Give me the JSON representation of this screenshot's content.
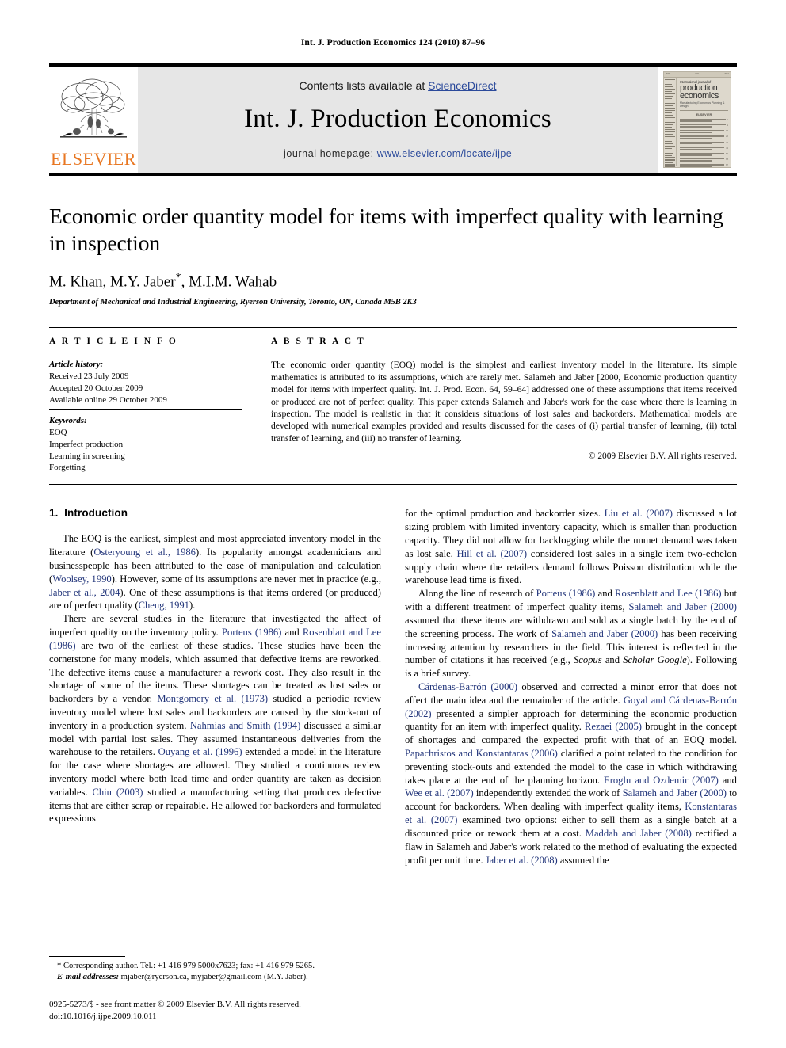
{
  "running_head": "Int. J. Production Economics 124 (2010) 87–96",
  "masthead": {
    "contents_prefix": "Contents lists available at ",
    "sciencedirect": "ScienceDirect",
    "journal_title": "Int. J. Production Economics",
    "homepage_prefix": "journal homepage: ",
    "homepage_url": "www.elsevier.com/locate/ijpe",
    "publisher": "ELSEVIER",
    "cover": {
      "line1": "International journal of",
      "line2a": "production",
      "line2b": "economics",
      "line3": "Manufacturing Economics Planning & Design"
    },
    "link_color": "#2b4a9b",
    "elsevier_orange": "#E87722"
  },
  "title": "Economic order quantity model for items with imperfect quality with learning in inspection",
  "authors": "M. Khan, M.Y. Jaber",
  "authors_tail": ", M.I.M. Wahab",
  "affiliation": "Department of Mechanical and Industrial Engineering, Ryerson University, Toronto, ON, Canada M5B 2K3",
  "article_info": {
    "label": "A R T I C L E   I N F O",
    "history_label": "Article history:",
    "history": [
      "Received 23 July 2009",
      "Accepted 20 October 2009",
      "Available online 29 October 2009"
    ],
    "keywords_label": "Keywords:",
    "keywords": [
      "EOQ",
      "Imperfect production",
      "Learning in screening",
      "Forgetting"
    ]
  },
  "abstract": {
    "label": "A B S T R A C T",
    "text": "The economic order quantity (EOQ) model is the simplest and earliest inventory model in the literature. Its simple mathematics is attributed to its assumptions, which are rarely met. Salameh and Jaber [2000, Economic production quantity model for items with imperfect quality. Int. J. Prod. Econ. 64, 59–64] addressed one of these assumptions that items received or produced are not of perfect quality. This paper extends Salameh and Jaber's work for the case where there is learning in inspection. The model is realistic in that it considers situations of lost sales and backorders. Mathematical models are developed with numerical examples provided and results discussed for the cases of (i) partial transfer of learning, (ii) total transfer of learning, and (iii) no transfer of learning.",
    "copyright": "© 2009 Elsevier B.V. All rights reserved."
  },
  "section": {
    "number": "1.",
    "heading": "Introduction"
  },
  "left_column": {
    "p1": {
      "s1": "The EOQ is the earliest, simplest and most appreciated inventory model in the literature (",
      "r1": "Osteryoung et al., 1986",
      "s2": "). Its popularity amongst academicians and businesspeople has been attributed to the ease of manipulation and calculation (",
      "r2": "Woolsey, 1990",
      "s3": "). However, some of its assumptions are never met in practice (e.g., ",
      "r3": "Jaber et al., 2004",
      "s4": "). One of these assumptions is that items ordered (or produced) are of perfect quality (",
      "r4": "Cheng, 1991",
      "s5": ")."
    },
    "p2": {
      "s1": "There are several studies in the literature that investigated the affect of imperfect quality on the inventory policy. ",
      "r1": "Porteus (1986)",
      "s2": " and ",
      "r2": "Rosenblatt and Lee (1986)",
      "s3": " are two of the earliest of these studies. These studies have been the cornerstone for many models, which assumed that defective items are reworked. The defective items cause a manufacturer a rework cost. They also result in the shortage of some of the items. These shortages can be treated as lost sales or backorders by a vendor. ",
      "r3": "Montgomery et al. (1973)",
      "s4": " studied a periodic review inventory model where lost sales and backorders are caused by the stock-out of inventory in a production system. ",
      "r4": "Nahmias and Smith (1994)",
      "s5": " discussed a similar model with partial lost sales. They assumed instantaneous deliveries from the warehouse to the retailers. ",
      "r5": "Ouyang et al. (1996)",
      "s6": " extended a model in the literature for the case where shortages are allowed. They studied a continuous review inventory model where both lead time and order quantity are taken as decision variables. ",
      "r6": "Chiu (2003)",
      "s7": " studied a manufacturing setting that produces defective items that are either scrap or repairable. He allowed for backorders and formulated expressions"
    }
  },
  "right_column": {
    "p1": {
      "s1": "for the optimal production and backorder sizes. ",
      "r1": "Liu et al. (2007)",
      "s2": " discussed a lot sizing problem with limited inventory capacity, which is smaller than production capacity. They did not allow for backlogging while the unmet demand was taken as lost sale. ",
      "r2": "Hill et al. (2007)",
      "s3": " considered lost sales in a single item two-echelon supply chain where the retailers demand follows Poisson distribution while the warehouse lead time is fixed."
    },
    "p2": {
      "s1": "Along the line of research of ",
      "r1": "Porteus (1986)",
      "s2": " and ",
      "r2": "Rosenblatt and Lee (1986)",
      "s3": " but with a different treatment of imperfect quality items, ",
      "r3": "Salameh and Jaber (2000)",
      "s4": " assumed that these items are withdrawn and sold as a single batch by the end of the screening process. The work of ",
      "r4": "Salameh and Jaber (2000)",
      "s5": " has been receiving increasing attention by researchers in the field. This interest is reflected in the number of citations it has received (e.g., ",
      "i1": "Scopus",
      "s6": " and ",
      "i2": "Scholar Google",
      "s7": "). Following is a brief survey."
    },
    "p3": {
      "r1": "Cárdenas-Barrón (2000)",
      "s1": " observed and corrected a minor error that does not affect the main idea and the remainder of the article. ",
      "r2": "Goyal and Cárdenas-Barrón (2002)",
      "s2": " presented a simpler approach for determining the economic production quantity for an item with imperfect quality. ",
      "r3": "Rezaei (2005)",
      "s3": " brought in the concept of shortages and compared the expected profit with that of an EOQ model. ",
      "r4": "Papachristos and Konstantaras (2006)",
      "s4": " clarified a point related to the condition for preventing stock-outs and extended the model to the case in which withdrawing takes place at the end of the planning horizon. ",
      "r5": "Eroglu and Ozdemir (2007)",
      "s5": " and ",
      "r6": "Wee et al. (2007)",
      "s6": " independently extended the work of ",
      "r7": "Salameh and Jaber (2000)",
      "s7": " to account for backorders. When dealing with imperfect quality items, ",
      "r8": "Konstantaras et al. (2007)",
      "s8": " examined two options: either to sell them as a single batch at a discounted price or rework them at a cost. ",
      "r9": "Maddah and Jaber (2008)",
      "s9": " rectified a flaw in Salameh and Jaber's work related to the method of evaluating the expected profit per unit time. ",
      "r10": "Jaber et al. (2008)",
      "s10": " assumed the"
    }
  },
  "footnotes": {
    "corresponding": "* Corresponding author. Tel.: +1 416 979 5000x7623; fax: +1 416 979 5265.",
    "email_label": "E-mail addresses:",
    "emails": " mjaber@ryerson.ca, myjaber@gmail.com (M.Y. Jaber).",
    "issn_line": "0925-5273/$ - see front matter © 2009 Elsevier B.V. All rights reserved.",
    "doi_line": "doi:10.1016/j.ijpe.2009.10.011"
  }
}
